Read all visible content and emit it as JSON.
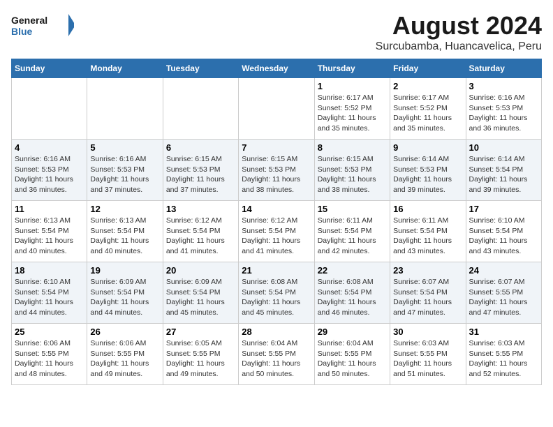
{
  "header": {
    "logo_line1": "General",
    "logo_line2": "Blue",
    "title": "August 2024",
    "subtitle": "Surcubamba, Huancavelica, Peru"
  },
  "weekdays": [
    "Sunday",
    "Monday",
    "Tuesday",
    "Wednesday",
    "Thursday",
    "Friday",
    "Saturday"
  ],
  "weeks": [
    [
      {
        "day": "",
        "info": ""
      },
      {
        "day": "",
        "info": ""
      },
      {
        "day": "",
        "info": ""
      },
      {
        "day": "",
        "info": ""
      },
      {
        "day": "1",
        "info": "Sunrise: 6:17 AM\nSunset: 5:52 PM\nDaylight: 11 hours\nand 35 minutes."
      },
      {
        "day": "2",
        "info": "Sunrise: 6:17 AM\nSunset: 5:52 PM\nDaylight: 11 hours\nand 35 minutes."
      },
      {
        "day": "3",
        "info": "Sunrise: 6:16 AM\nSunset: 5:53 PM\nDaylight: 11 hours\nand 36 minutes."
      }
    ],
    [
      {
        "day": "4",
        "info": "Sunrise: 6:16 AM\nSunset: 5:53 PM\nDaylight: 11 hours\nand 36 minutes."
      },
      {
        "day": "5",
        "info": "Sunrise: 6:16 AM\nSunset: 5:53 PM\nDaylight: 11 hours\nand 37 minutes."
      },
      {
        "day": "6",
        "info": "Sunrise: 6:15 AM\nSunset: 5:53 PM\nDaylight: 11 hours\nand 37 minutes."
      },
      {
        "day": "7",
        "info": "Sunrise: 6:15 AM\nSunset: 5:53 PM\nDaylight: 11 hours\nand 38 minutes."
      },
      {
        "day": "8",
        "info": "Sunrise: 6:15 AM\nSunset: 5:53 PM\nDaylight: 11 hours\nand 38 minutes."
      },
      {
        "day": "9",
        "info": "Sunrise: 6:14 AM\nSunset: 5:53 PM\nDaylight: 11 hours\nand 39 minutes."
      },
      {
        "day": "10",
        "info": "Sunrise: 6:14 AM\nSunset: 5:54 PM\nDaylight: 11 hours\nand 39 minutes."
      }
    ],
    [
      {
        "day": "11",
        "info": "Sunrise: 6:13 AM\nSunset: 5:54 PM\nDaylight: 11 hours\nand 40 minutes."
      },
      {
        "day": "12",
        "info": "Sunrise: 6:13 AM\nSunset: 5:54 PM\nDaylight: 11 hours\nand 40 minutes."
      },
      {
        "day": "13",
        "info": "Sunrise: 6:12 AM\nSunset: 5:54 PM\nDaylight: 11 hours\nand 41 minutes."
      },
      {
        "day": "14",
        "info": "Sunrise: 6:12 AM\nSunset: 5:54 PM\nDaylight: 11 hours\nand 41 minutes."
      },
      {
        "day": "15",
        "info": "Sunrise: 6:11 AM\nSunset: 5:54 PM\nDaylight: 11 hours\nand 42 minutes."
      },
      {
        "day": "16",
        "info": "Sunrise: 6:11 AM\nSunset: 5:54 PM\nDaylight: 11 hours\nand 43 minutes."
      },
      {
        "day": "17",
        "info": "Sunrise: 6:10 AM\nSunset: 5:54 PM\nDaylight: 11 hours\nand 43 minutes."
      }
    ],
    [
      {
        "day": "18",
        "info": "Sunrise: 6:10 AM\nSunset: 5:54 PM\nDaylight: 11 hours\nand 44 minutes."
      },
      {
        "day": "19",
        "info": "Sunrise: 6:09 AM\nSunset: 5:54 PM\nDaylight: 11 hours\nand 44 minutes."
      },
      {
        "day": "20",
        "info": "Sunrise: 6:09 AM\nSunset: 5:54 PM\nDaylight: 11 hours\nand 45 minutes."
      },
      {
        "day": "21",
        "info": "Sunrise: 6:08 AM\nSunset: 5:54 PM\nDaylight: 11 hours\nand 45 minutes."
      },
      {
        "day": "22",
        "info": "Sunrise: 6:08 AM\nSunset: 5:54 PM\nDaylight: 11 hours\nand 46 minutes."
      },
      {
        "day": "23",
        "info": "Sunrise: 6:07 AM\nSunset: 5:54 PM\nDaylight: 11 hours\nand 47 minutes."
      },
      {
        "day": "24",
        "info": "Sunrise: 6:07 AM\nSunset: 5:55 PM\nDaylight: 11 hours\nand 47 minutes."
      }
    ],
    [
      {
        "day": "25",
        "info": "Sunrise: 6:06 AM\nSunset: 5:55 PM\nDaylight: 11 hours\nand 48 minutes."
      },
      {
        "day": "26",
        "info": "Sunrise: 6:06 AM\nSunset: 5:55 PM\nDaylight: 11 hours\nand 49 minutes."
      },
      {
        "day": "27",
        "info": "Sunrise: 6:05 AM\nSunset: 5:55 PM\nDaylight: 11 hours\nand 49 minutes."
      },
      {
        "day": "28",
        "info": "Sunrise: 6:04 AM\nSunset: 5:55 PM\nDaylight: 11 hours\nand 50 minutes."
      },
      {
        "day": "29",
        "info": "Sunrise: 6:04 AM\nSunset: 5:55 PM\nDaylight: 11 hours\nand 50 minutes."
      },
      {
        "day": "30",
        "info": "Sunrise: 6:03 AM\nSunset: 5:55 PM\nDaylight: 11 hours\nand 51 minutes."
      },
      {
        "day": "31",
        "info": "Sunrise: 6:03 AM\nSunset: 5:55 PM\nDaylight: 11 hours\nand 52 minutes."
      }
    ]
  ]
}
